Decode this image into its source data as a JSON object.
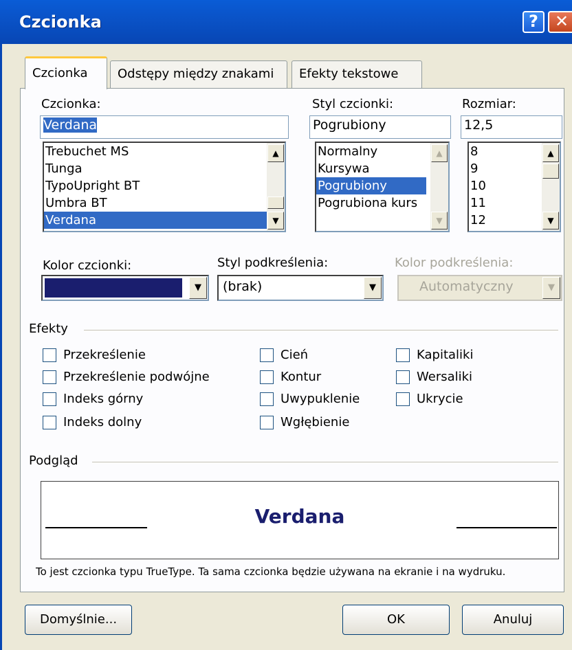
{
  "window": {
    "title": "Czcionka",
    "help_label": "?",
    "close_label": "✕"
  },
  "tabs": [
    {
      "label": "Czcionka",
      "active": true
    },
    {
      "label": "Odstępy między znakami",
      "active": false
    },
    {
      "label": "Efekty tekstowe",
      "active": false
    }
  ],
  "font": {
    "label": "Czcionka:",
    "value": "Verdana",
    "items": [
      "Trebuchet MS",
      "Tunga",
      "TypoUpright BT",
      "Umbra BT",
      "Verdana"
    ],
    "selected": "Verdana"
  },
  "style": {
    "label": "Styl czcionki:",
    "value": "Pogrubiony",
    "items": [
      "Normalny",
      "Kursywa",
      "Pogrubiony",
      "Pogrubiona kurs"
    ],
    "selected": "Pogrubiony"
  },
  "size": {
    "label": "Rozmiar:",
    "value": "12,5",
    "items": [
      "8",
      "9",
      "10",
      "11",
      "12"
    ]
  },
  "color": {
    "label": "Kolor czcionki:",
    "swatch": "#1a1e6e"
  },
  "underline_style": {
    "label": "Styl podkreślenia:",
    "value": "(brak)"
  },
  "underline_color": {
    "label": "Kolor podkreślenia:",
    "value": "Automatyczny"
  },
  "effects": {
    "title": "Efekty",
    "col1": [
      "Przekreślenie",
      "Przekreślenie podwójne",
      "Indeks górny",
      "Indeks dolny"
    ],
    "col2": [
      "Cień",
      "Kontur",
      "Uwypuklenie",
      "Wgłębienie"
    ],
    "col3": [
      "Kapitaliki",
      "Wersaliki",
      "Ukrycie"
    ]
  },
  "preview": {
    "title": "Podgląd",
    "sample": "Verdana",
    "note": "To jest czcionka typu TrueType. Ta sama czcionka będzie używana na ekranie i na wydruku."
  },
  "buttons": {
    "default": "Domyślnie...",
    "ok": "OK",
    "cancel": "Anuluj"
  }
}
